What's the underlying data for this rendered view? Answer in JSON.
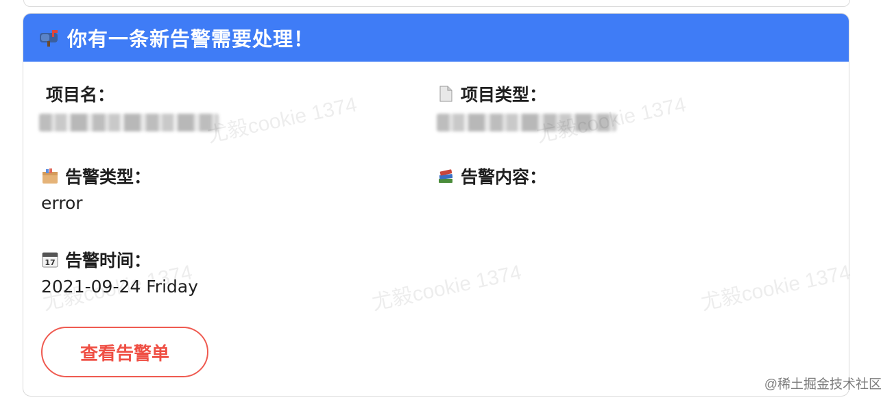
{
  "header": {
    "title": "你有一条新告警需要处理！",
    "bg_color": "#3f7cf6",
    "icon": "mailbox-icon"
  },
  "fields": {
    "project_name": {
      "label": "项目名：",
      "value": ""
    },
    "project_type": {
      "label": "项目类型：",
      "value": "",
      "icon": "page-icon"
    },
    "alert_type": {
      "label": "告警类型：",
      "value": "error",
      "icon": "card-box-icon"
    },
    "alert_content": {
      "label": "告警内容：",
      "value": "",
      "icon": "books-icon"
    },
    "alert_time": {
      "label": "告警时间：",
      "value": "2021-09-24 Friday",
      "icon": "calendar-icon"
    }
  },
  "button": {
    "label": "查看告警单",
    "color": "#ef4f44"
  },
  "watermarks": {
    "text": "尤毅cookie 1374",
    "site": "@稀土掘金技术社区"
  }
}
